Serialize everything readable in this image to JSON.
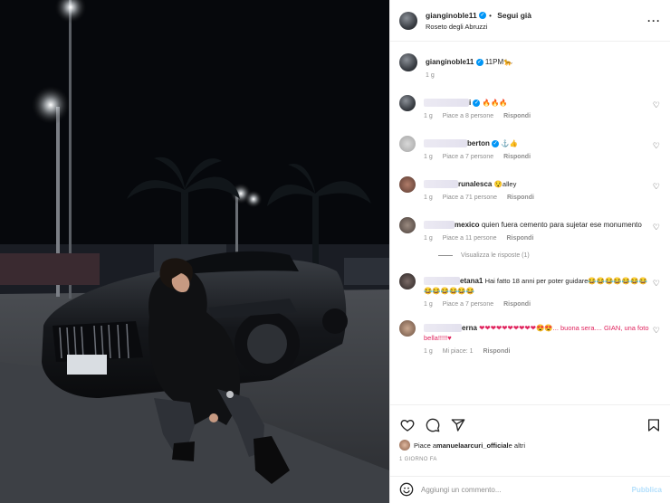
{
  "post": {
    "username": "gianginoble11",
    "follow_label": "Segui già",
    "location": "Roseto degli Abruzzi",
    "caption": "11PM🐆",
    "caption_age": "1 g"
  },
  "comments": [
    {
      "user_visible": "i",
      "text": "🔥🔥🔥",
      "age": "1 g",
      "likes": "Piace a 8 persone",
      "reply": "Rispondi"
    },
    {
      "user_visible": "berton",
      "text": "⚓👍",
      "age": "1 g",
      "likes": "Piace a 7 persone",
      "reply": "Rispondi"
    },
    {
      "user_visible": "runalesca",
      "text": "😯alley",
      "age": "1 g",
      "likes": "Piace a 71 persone",
      "reply": "Rispondi"
    },
    {
      "user_visible": "mexico",
      "text": "quien fuera cemento para sujetar ese monumento",
      "age": "1 g",
      "likes": "Piace a 11 persone",
      "reply": "Rispondi",
      "view_replies": "Visualizza le risposte (1)"
    },
    {
      "user_visible": "etana1",
      "text": "Hai fatto 18 anni per poter guidare😂😂😂😂😂😂😂😂😂😂😂😂😂",
      "age": "1 g",
      "likes": "Piace a 7 persone",
      "reply": "Rispondi"
    },
    {
      "user_visible": "erna",
      "text": "❤❤❤❤❤❤❤❤❤❤😍😍... buona sera.... GIAN, una foto bella!!!!!♥",
      "age": "1 g",
      "likes": "Mi piace: 1",
      "reply": "Rispondi"
    }
  ],
  "footer": {
    "liked_by_prefix": "Piace a ",
    "liked_by_user": "manuelaarcuri_official",
    "liked_by_suffix": " e altri",
    "date": "1 GIORNO FA",
    "comment_placeholder": "Aggiungi un commento...",
    "publish_label": "Pubblica"
  },
  "icons": {
    "more": "more-options-icon",
    "like": "heart-icon",
    "comment": "comment-icon",
    "share": "share-icon",
    "save": "bookmark-icon",
    "emoji": "emoji-icon"
  }
}
